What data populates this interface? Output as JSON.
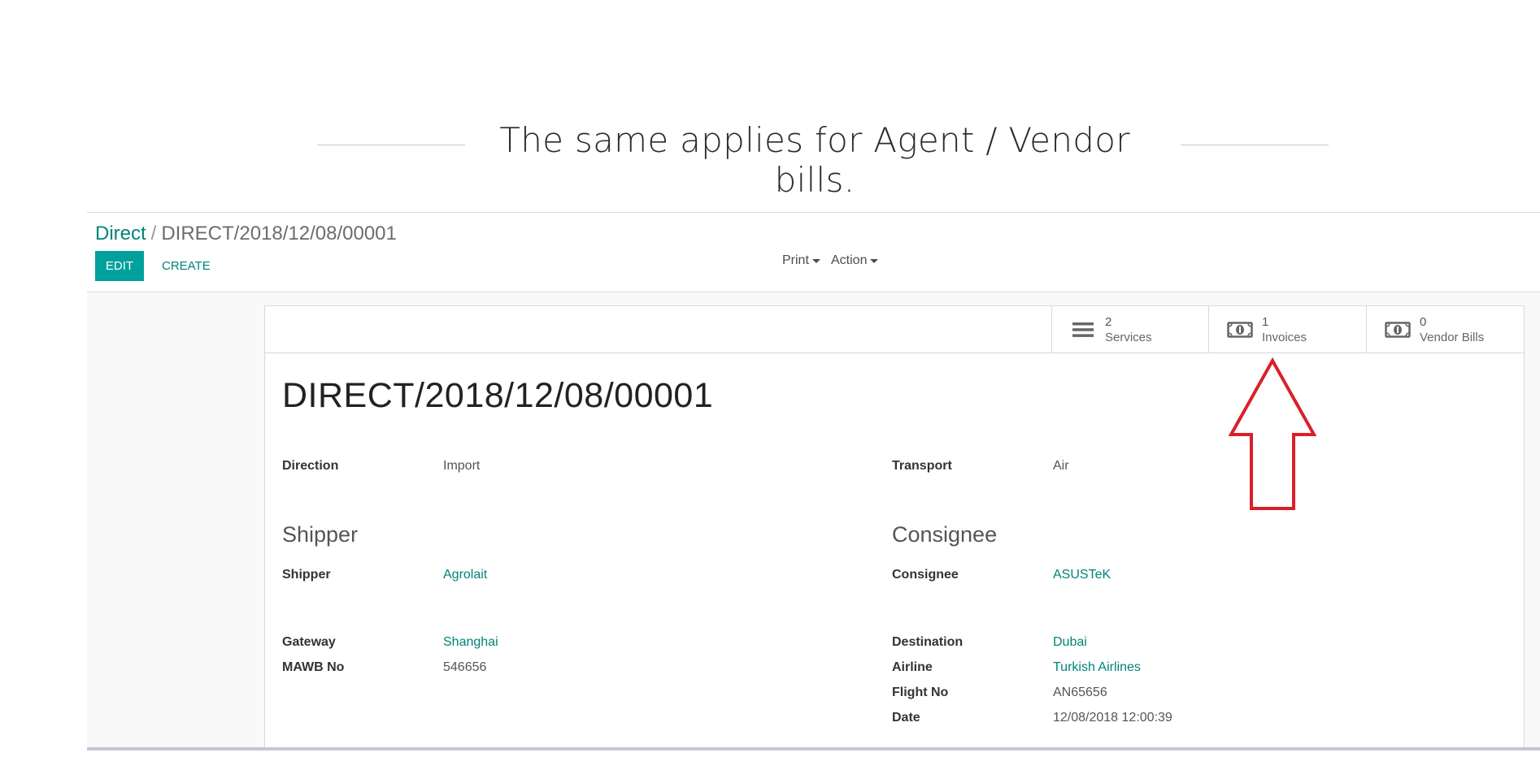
{
  "slide": {
    "heading": "The same applies for Agent / Vendor bills."
  },
  "breadcrumb": {
    "parent": "Direct",
    "separator": "/",
    "current": "DIRECT/2018/12/08/00001"
  },
  "toolbar": {
    "edit_label": "EDIT",
    "create_label": "CREATE",
    "print_label": "Print",
    "action_label": "Action"
  },
  "stat_buttons": [
    {
      "value": "2",
      "label": "Services",
      "icon": "list-icon"
    },
    {
      "value": "1",
      "label": "Invoices",
      "icon": "money-icon"
    },
    {
      "value": "0",
      "label": "Vendor Bills",
      "icon": "money-icon"
    }
  ],
  "record": {
    "title": "DIRECT/2018/12/08/00001",
    "left": {
      "direction_label": "Direction",
      "direction_value": "Import",
      "section_title": "Shipper",
      "shipper_label": "Shipper",
      "shipper_value": "Agrolait",
      "gateway_label": "Gateway",
      "gateway_value": "Shanghai",
      "mawb_label": "MAWB No",
      "mawb_value": "546656"
    },
    "right": {
      "transport_label": "Transport",
      "transport_value": "Air",
      "section_title": "Consignee",
      "consignee_label": "Consignee",
      "consignee_value": "ASUSTeK",
      "destination_label": "Destination",
      "destination_value": "Dubai",
      "airline_label": "Airline",
      "airline_value": "Turkish Airlines",
      "flight_label": "Flight No",
      "flight_value": "AN65656",
      "date_label": "Date",
      "date_value": "12/08/2018 12:00:39"
    }
  },
  "colors": {
    "primary": "#00a09d",
    "link": "#00837a",
    "annotation": "#d9202a"
  },
  "annotation": {
    "icon": "up-arrow-icon"
  }
}
